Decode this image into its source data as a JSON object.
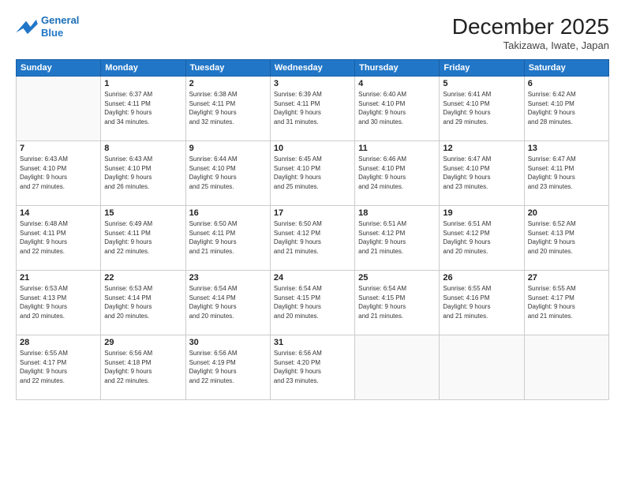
{
  "header": {
    "logo_line1": "General",
    "logo_line2": "Blue",
    "month": "December 2025",
    "location": "Takizawa, Iwate, Japan"
  },
  "weekdays": [
    "Sunday",
    "Monday",
    "Tuesday",
    "Wednesday",
    "Thursday",
    "Friday",
    "Saturday"
  ],
  "weeks": [
    [
      {
        "day": "",
        "info": ""
      },
      {
        "day": "1",
        "info": "Sunrise: 6:37 AM\nSunset: 4:11 PM\nDaylight: 9 hours\nand 34 minutes."
      },
      {
        "day": "2",
        "info": "Sunrise: 6:38 AM\nSunset: 4:11 PM\nDaylight: 9 hours\nand 32 minutes."
      },
      {
        "day": "3",
        "info": "Sunrise: 6:39 AM\nSunset: 4:11 PM\nDaylight: 9 hours\nand 31 minutes."
      },
      {
        "day": "4",
        "info": "Sunrise: 6:40 AM\nSunset: 4:10 PM\nDaylight: 9 hours\nand 30 minutes."
      },
      {
        "day": "5",
        "info": "Sunrise: 6:41 AM\nSunset: 4:10 PM\nDaylight: 9 hours\nand 29 minutes."
      },
      {
        "day": "6",
        "info": "Sunrise: 6:42 AM\nSunset: 4:10 PM\nDaylight: 9 hours\nand 28 minutes."
      }
    ],
    [
      {
        "day": "7",
        "info": "Sunrise: 6:43 AM\nSunset: 4:10 PM\nDaylight: 9 hours\nand 27 minutes."
      },
      {
        "day": "8",
        "info": "Sunrise: 6:43 AM\nSunset: 4:10 PM\nDaylight: 9 hours\nand 26 minutes."
      },
      {
        "day": "9",
        "info": "Sunrise: 6:44 AM\nSunset: 4:10 PM\nDaylight: 9 hours\nand 25 minutes."
      },
      {
        "day": "10",
        "info": "Sunrise: 6:45 AM\nSunset: 4:10 PM\nDaylight: 9 hours\nand 25 minutes."
      },
      {
        "day": "11",
        "info": "Sunrise: 6:46 AM\nSunset: 4:10 PM\nDaylight: 9 hours\nand 24 minutes."
      },
      {
        "day": "12",
        "info": "Sunrise: 6:47 AM\nSunset: 4:10 PM\nDaylight: 9 hours\nand 23 minutes."
      },
      {
        "day": "13",
        "info": "Sunrise: 6:47 AM\nSunset: 4:11 PM\nDaylight: 9 hours\nand 23 minutes."
      }
    ],
    [
      {
        "day": "14",
        "info": "Sunrise: 6:48 AM\nSunset: 4:11 PM\nDaylight: 9 hours\nand 22 minutes."
      },
      {
        "day": "15",
        "info": "Sunrise: 6:49 AM\nSunset: 4:11 PM\nDaylight: 9 hours\nand 22 minutes."
      },
      {
        "day": "16",
        "info": "Sunrise: 6:50 AM\nSunset: 4:11 PM\nDaylight: 9 hours\nand 21 minutes."
      },
      {
        "day": "17",
        "info": "Sunrise: 6:50 AM\nSunset: 4:12 PM\nDaylight: 9 hours\nand 21 minutes."
      },
      {
        "day": "18",
        "info": "Sunrise: 6:51 AM\nSunset: 4:12 PM\nDaylight: 9 hours\nand 21 minutes."
      },
      {
        "day": "19",
        "info": "Sunrise: 6:51 AM\nSunset: 4:12 PM\nDaylight: 9 hours\nand 20 minutes."
      },
      {
        "day": "20",
        "info": "Sunrise: 6:52 AM\nSunset: 4:13 PM\nDaylight: 9 hours\nand 20 minutes."
      }
    ],
    [
      {
        "day": "21",
        "info": "Sunrise: 6:53 AM\nSunset: 4:13 PM\nDaylight: 9 hours\nand 20 minutes."
      },
      {
        "day": "22",
        "info": "Sunrise: 6:53 AM\nSunset: 4:14 PM\nDaylight: 9 hours\nand 20 minutes."
      },
      {
        "day": "23",
        "info": "Sunrise: 6:54 AM\nSunset: 4:14 PM\nDaylight: 9 hours\nand 20 minutes."
      },
      {
        "day": "24",
        "info": "Sunrise: 6:54 AM\nSunset: 4:15 PM\nDaylight: 9 hours\nand 20 minutes."
      },
      {
        "day": "25",
        "info": "Sunrise: 6:54 AM\nSunset: 4:15 PM\nDaylight: 9 hours\nand 21 minutes."
      },
      {
        "day": "26",
        "info": "Sunrise: 6:55 AM\nSunset: 4:16 PM\nDaylight: 9 hours\nand 21 minutes."
      },
      {
        "day": "27",
        "info": "Sunrise: 6:55 AM\nSunset: 4:17 PM\nDaylight: 9 hours\nand 21 minutes."
      }
    ],
    [
      {
        "day": "28",
        "info": "Sunrise: 6:55 AM\nSunset: 4:17 PM\nDaylight: 9 hours\nand 22 minutes."
      },
      {
        "day": "29",
        "info": "Sunrise: 6:56 AM\nSunset: 4:18 PM\nDaylight: 9 hours\nand 22 minutes."
      },
      {
        "day": "30",
        "info": "Sunrise: 6:56 AM\nSunset: 4:19 PM\nDaylight: 9 hours\nand 22 minutes."
      },
      {
        "day": "31",
        "info": "Sunrise: 6:56 AM\nSunset: 4:20 PM\nDaylight: 9 hours\nand 23 minutes."
      },
      {
        "day": "",
        "info": ""
      },
      {
        "day": "",
        "info": ""
      },
      {
        "day": "",
        "info": ""
      }
    ]
  ]
}
